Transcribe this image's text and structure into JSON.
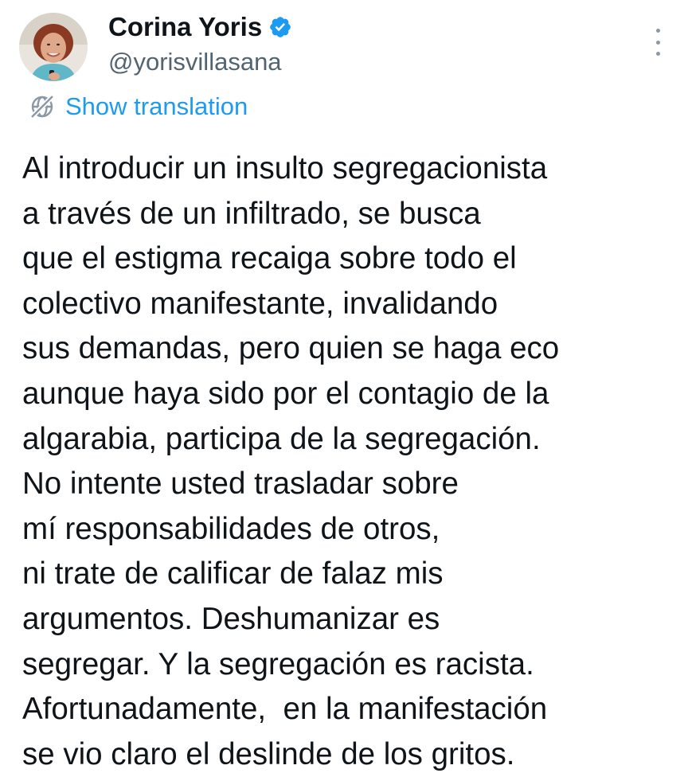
{
  "author": {
    "display_name": "Corina Yoris",
    "handle": "@yorisvillasana",
    "verified": true,
    "verified_color": "#1d9bf0"
  },
  "actions": {
    "translate_label": "Show translation",
    "translate_icon": "globe-slash-icon",
    "more_icon": "more-vertical-icon"
  },
  "tweet": {
    "lines": [
      "Al introducir un insulto segregacionista",
      "a través de un infiltrado, se busca",
      "que el estigma recaiga sobre todo el",
      "colectivo manifestante, invalidando",
      "sus demandas, pero quien se haga eco",
      "aunque haya sido por el contagio de la",
      "algarabia, participa de la segregación.",
      "No intente usted trasladar sobre",
      "mí responsabilidades de otros,",
      "ni trate de calificar de falaz mis",
      "argumentos. Deshumanizar es",
      "segregar. Y la segregación es racista.",
      "Afortunadamente,  en la manifestación",
      "se vio claro el deslinde de los gritos."
    ]
  },
  "colors": {
    "text_primary": "#0f1419",
    "text_secondary": "#536471",
    "link": "#1d9bf0"
  }
}
